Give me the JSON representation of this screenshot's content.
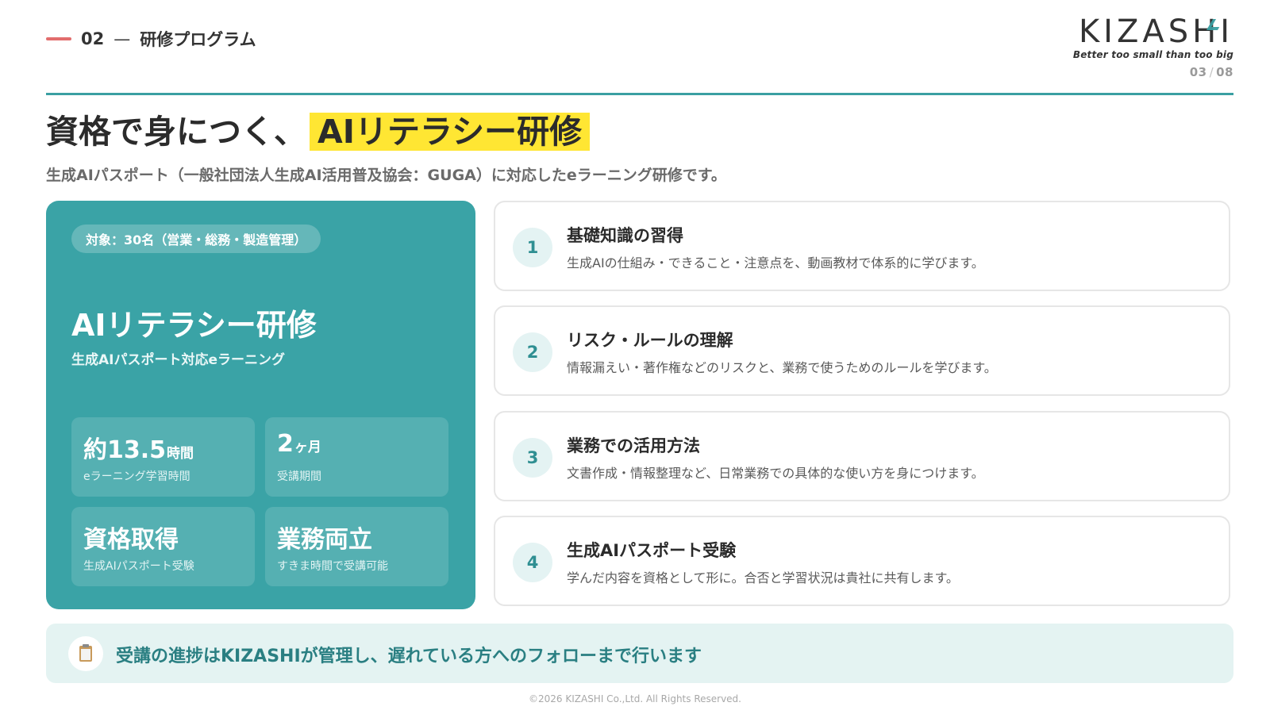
{
  "header": {
    "section_number": "02",
    "section_dash": "—",
    "section_title": "研修プログラム",
    "logo_wordmark": "KIZASHI",
    "logo_tagline": "Better too small than too big",
    "page_current": "03",
    "page_separator": "/",
    "page_total": "08"
  },
  "title": {
    "lead": "資格で身につく、",
    "highlight": "AIリテラシー研修"
  },
  "subtitle": "生成AIパスポート（一般社団法人生成AI活用普及協会：GUGA）に対応したeラーニング研修です。",
  "feature": {
    "target": "対象：30名（営業・総務・製造管理）",
    "title": "AIリテラシー研修",
    "subtitle": "生成AIパスポート対応eラーニング",
    "stats": [
      {
        "value": "約13.5",
        "unit": "時間",
        "caption": "eラーニング学習時間"
      },
      {
        "value": "2",
        "unit": "ヶ月",
        "caption": "受講期間"
      },
      {
        "value": "資格取得",
        "unit": "",
        "caption": "生成AIパスポート受験"
      },
      {
        "value": "業務両立",
        "unit": "",
        "caption": "すきま時間で受講可能"
      }
    ]
  },
  "steps": [
    {
      "number": "1",
      "title": "基礎知識の習得",
      "description": "生成AIの仕組み・できること・注意点を、動画教材で体系的に学びます。"
    },
    {
      "number": "2",
      "title": "リスク・ルールの理解",
      "description": "情報漏えい・著作権などのリスクと、業務で使うためのルールを学びます。"
    },
    {
      "number": "3",
      "title": "業務での活用方法",
      "description": "文書作成・情報整理など、日常業務での具体的な使い方を身につけます。"
    },
    {
      "number": "4",
      "title": "生成AIパスポート受験",
      "description": "学んだ内容を資格として形に。合否と学習状況は貴社に共有します。"
    }
  ],
  "banner": {
    "icon": "clipboard-icon",
    "text": "受講の進捗はKIZASHIが管理し、遅れている方へのフォローまで行います"
  },
  "footer": "©2026 KIZASHI Co.,Ltd. All Rights Reserved.",
  "colors": {
    "teal": "#3aa3a6",
    "highlight_yellow": "#ffe633",
    "accent_red": "#e26d6d",
    "banner_bg": "#e4f3f2"
  }
}
